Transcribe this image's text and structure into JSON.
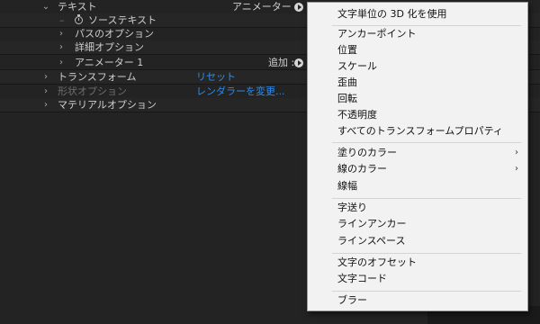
{
  "layers": [
    {
      "label": "テキスト",
      "expanded": true,
      "right_label": "アニメーター :"
    },
    {
      "label": "ソーステキスト",
      "icon": "stopwatch-icon"
    },
    {
      "label": "パスのオプション"
    },
    {
      "label": "詳細オプション"
    },
    {
      "label": "アニメーター 1",
      "right_label": "追加 :"
    },
    {
      "label": "トランスフォーム",
      "link": "リセット"
    },
    {
      "label": "形状オプション",
      "link": "レンダラーを変更..."
    },
    {
      "label": "マテリアルオプション"
    }
  ],
  "menu": {
    "items": [
      {
        "label": "文字単位の 3D 化を使用"
      },
      {
        "label": "アンカーポイント"
      },
      {
        "label": "位置"
      },
      {
        "label": "スケール"
      },
      {
        "label": "歪曲"
      },
      {
        "label": "回転"
      },
      {
        "label": "不透明度"
      },
      {
        "label": "すべてのトランスフォームプロパティ"
      },
      {
        "label": "塗りのカラー",
        "submenu": true
      },
      {
        "label": "線のカラー",
        "submenu": true
      },
      {
        "label": "線幅"
      },
      {
        "label": "字送り"
      },
      {
        "label": "ラインアンカー"
      },
      {
        "label": "ラインスペース"
      },
      {
        "label": "文字のオフセット"
      },
      {
        "label": "文字コード"
      },
      {
        "label": "ブラー"
      }
    ]
  },
  "colors": {
    "panel_bg": "#232323",
    "link": "#2d8ceb",
    "menu_bg": "#f2f2f2"
  }
}
